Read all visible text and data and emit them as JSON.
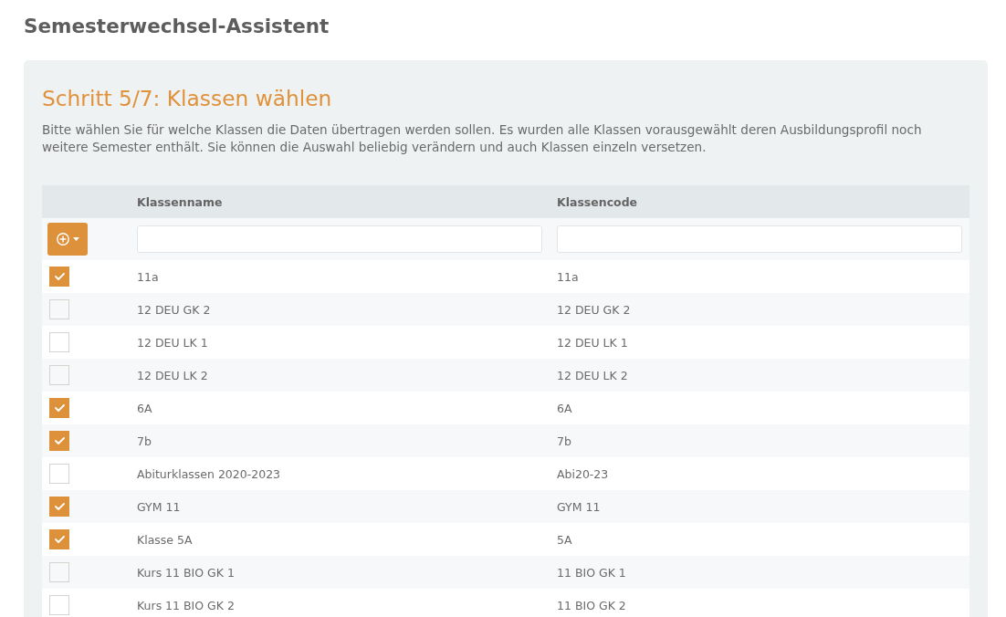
{
  "page": {
    "title": "Semesterwechsel-Assistent"
  },
  "step": {
    "title": "Schritt 5/7: Klassen wählen",
    "description": "Bitte wählen Sie für welche Klassen die Daten übertragen werden sollen. Es wurden alle Klassen vorausgewählt deren Ausbildungsprofil noch weitere Semester enthält. Sie können die Auswahl beliebig verändern und auch Klassen einzeln versetzen."
  },
  "table": {
    "columns": [
      "Klassenname",
      "Klassencode"
    ],
    "rows": [
      {
        "name": "11a",
        "code": "11a",
        "checked": true
      },
      {
        "name": "12 DEU GK 2",
        "code": "12 DEU GK 2",
        "checked": false
      },
      {
        "name": "12 DEU LK 1",
        "code": "12 DEU LK 1",
        "checked": false
      },
      {
        "name": "12 DEU LK 2",
        "code": "12 DEU LK 2",
        "checked": false
      },
      {
        "name": "6A",
        "code": "6A",
        "checked": true
      },
      {
        "name": "7b",
        "code": "7b",
        "checked": true
      },
      {
        "name": "Abiturklassen 2020-2023",
        "code": "Abi20-23",
        "checked": false
      },
      {
        "name": "GYM 11",
        "code": "GYM 11",
        "checked": true
      },
      {
        "name": "Klasse 5A",
        "code": "5A",
        "checked": true
      },
      {
        "name": "Kurs 11 BIO GK 1",
        "code": "11 BIO GK 1",
        "checked": false
      },
      {
        "name": "Kurs 11 BIO GK 2",
        "code": "11 BIO GK 2",
        "checked": false
      }
    ]
  }
}
